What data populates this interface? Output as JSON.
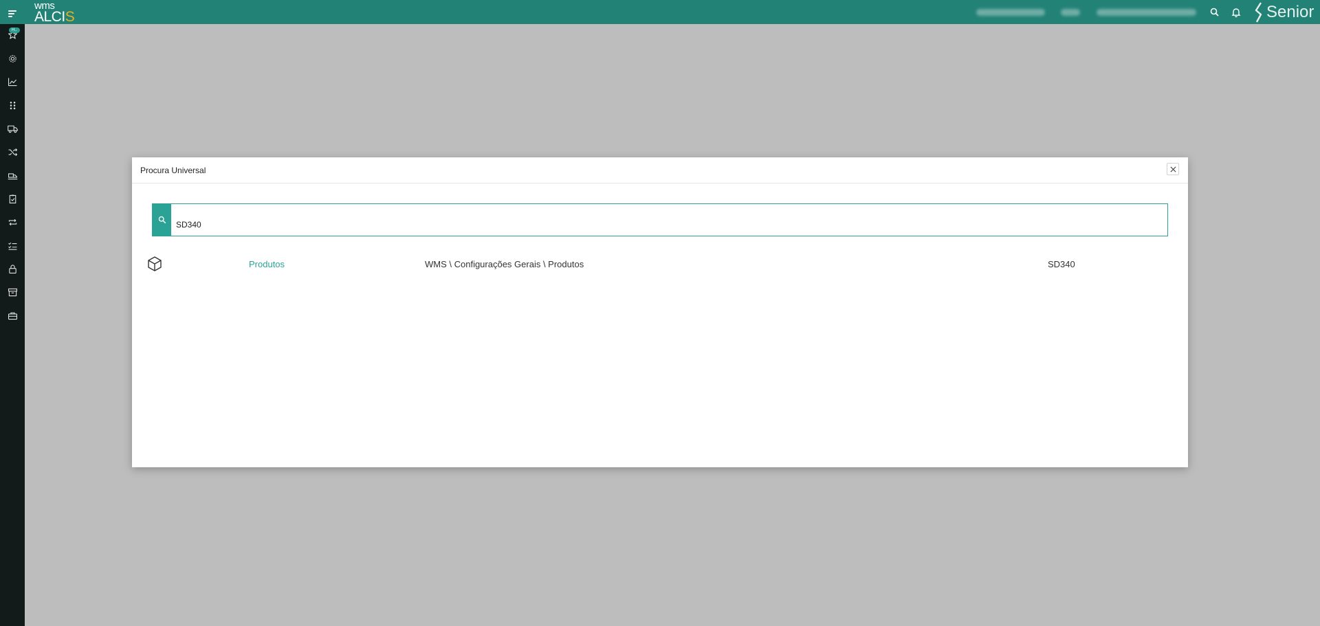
{
  "header": {
    "menu_icon": "hamburger-menu-icon",
    "logo_top": "wms",
    "logo_main": "ALCI",
    "logo_accent": "S",
    "brand": "Senior",
    "search_icon": "search-icon",
    "notification_icon": "bell-icon"
  },
  "sidebar": {
    "favorites_badge": "H..",
    "items": [
      {
        "icon": "star-icon"
      },
      {
        "icon": "gear-icon"
      },
      {
        "icon": "line-chart-icon"
      },
      {
        "icon": "grid-dots-icon"
      },
      {
        "icon": "truck-icon"
      },
      {
        "icon": "shuffle-icon"
      },
      {
        "icon": "truck-loading-icon"
      },
      {
        "icon": "clipboard-check-icon"
      },
      {
        "icon": "repeat-icon"
      },
      {
        "icon": "checklist-icon"
      },
      {
        "icon": "lock-icon"
      },
      {
        "icon": "archive-icon"
      },
      {
        "icon": "briefcase-icon"
      }
    ]
  },
  "modal": {
    "title": "Procura Universal",
    "close_icon": "close-icon",
    "search_value": "SD340",
    "results": [
      {
        "icon": "cube-icon",
        "name": "Produtos",
        "path": "WMS \\ Configurações Gerais \\ Produtos",
        "code": "SD340"
      }
    ]
  },
  "colors": {
    "topbar": "#238276",
    "sidebar": "#121a1a",
    "accent": "#2aa396",
    "logo_accent": "#e3b123",
    "backdrop": "#bdbdbd"
  }
}
